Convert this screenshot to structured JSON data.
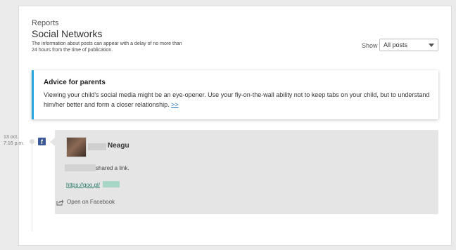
{
  "header": {
    "breadcrumb": "Reports",
    "title": "Social Networks",
    "subtitle": "The information about posts can appear with a delay of no more than 24 hours from the time of publication."
  },
  "filter": {
    "label": "Show",
    "selected": "All posts"
  },
  "advice": {
    "title": "Advice for parents",
    "text": "Viewing your child's social media might be an eye-opener. Use your fly-on-the-wall ability not to keep tabs on your child, but to understand him/her better and form a closer relationship.",
    "link": ">>"
  },
  "timeline": {
    "date_line1": "13 oct.",
    "date_line2": "7:16 p.m.",
    "network_icon": "facebook-icon"
  },
  "post": {
    "author_name": "Neagu",
    "action": "shared a link.",
    "link_text": "https://goo.gl/",
    "open_label": "Open on Facebook",
    "open_icon": "external-share-icon"
  },
  "colors": {
    "accent": "#2aa6df",
    "facebook": "#3b5998",
    "link": "#2b7c6d"
  }
}
